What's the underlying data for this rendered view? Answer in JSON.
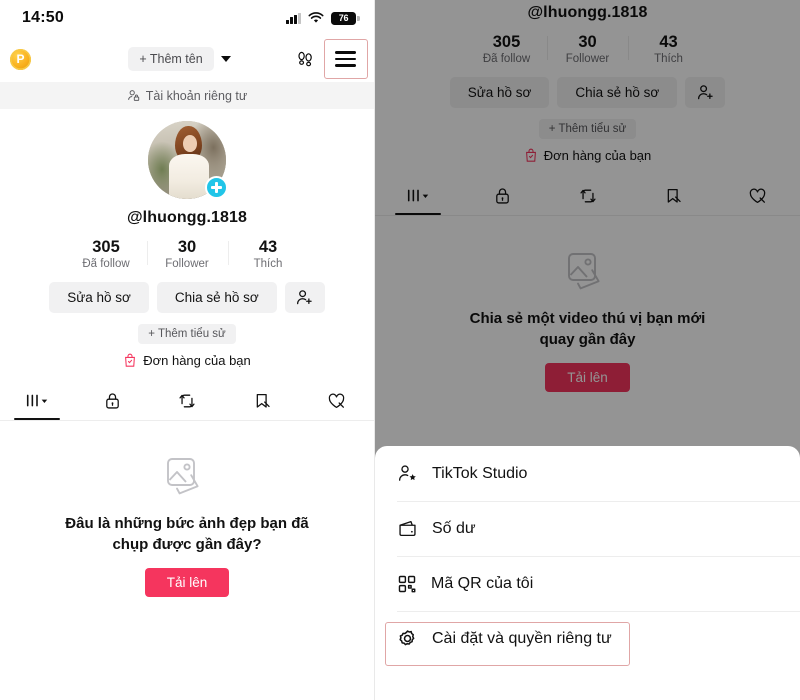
{
  "status_bar": {
    "time": "14:50",
    "battery_level": "76",
    "signal_icon": "cellular-bars-icon",
    "wifi_icon": "wifi-icon",
    "battery_icon": "battery-icon"
  },
  "top_nav": {
    "profile_badge_letter": "P",
    "profile_badge_icon": "points-badge-icon",
    "add_name_label": "+ Thêm tên",
    "chevron_icon": "chevron-down-icon",
    "footprints_icon": "footprints-icon",
    "menu_icon": "hamburger-menu-icon"
  },
  "private_banner": {
    "label": "Tài khoản riêng tư",
    "icon": "person-lock-icon"
  },
  "profile": {
    "avatar_icon": "user-avatar",
    "add_story_icon": "plus-badge-icon",
    "handle": "@lhuongg.1818",
    "stats": [
      {
        "value": "305",
        "label": "Đã follow"
      },
      {
        "value": "30",
        "label": "Follower"
      },
      {
        "value": "43",
        "label": "Thích"
      }
    ],
    "actions": {
      "edit_profile": "Sửa hồ sơ",
      "share_profile": "Chia sẻ hồ sơ",
      "add_friend_icon": "add-person-icon"
    },
    "add_bio": "+ Thêm tiểu sử",
    "orders_label": "Đơn hàng của bạn",
    "orders_icon": "shopping-bag-icon"
  },
  "tabs": [
    {
      "name": "grid",
      "icon": "grid-dropdown-icon",
      "active": true
    },
    {
      "name": "private",
      "icon": "lock-icon",
      "active": false
    },
    {
      "name": "repost",
      "icon": "repost-icon",
      "active": false
    },
    {
      "name": "saved",
      "icon": "bookmark-hidden-icon",
      "active": false
    },
    {
      "name": "liked",
      "icon": "heart-hidden-icon",
      "active": false
    }
  ],
  "empty_state_left": {
    "image_icon": "photo-stack-icon",
    "title": "Đâu là những bức ảnh đẹp bạn đã chụp được gần đây?",
    "upload_label": "Tải lên"
  },
  "empty_state_right": {
    "image_icon": "photo-stack-icon",
    "title": "Chia sẻ một video thú vị bạn mới quay gần đây",
    "upload_label": "Tải lên"
  },
  "bottom_sheet": {
    "items": [
      {
        "label": "TikTok Studio",
        "icon": "person-star-icon",
        "highlighted": false
      },
      {
        "label": "Số dư",
        "icon": "wallet-icon",
        "highlighted": false
      },
      {
        "label": "Mã QR của tôi",
        "icon": "qr-code-icon",
        "highlighted": false
      },
      {
        "label": "Cài đặt và quyền riêng tư",
        "icon": "gear-icon",
        "highlighted": true
      }
    ]
  },
  "colors": {
    "accent_red": "#f5355e",
    "badge_cyan": "#21c5e8",
    "highlight_border": "#e0a6a6",
    "chip_gray": "#f1f1f2",
    "overlay": "rgba(0,0,0,0.42)"
  }
}
